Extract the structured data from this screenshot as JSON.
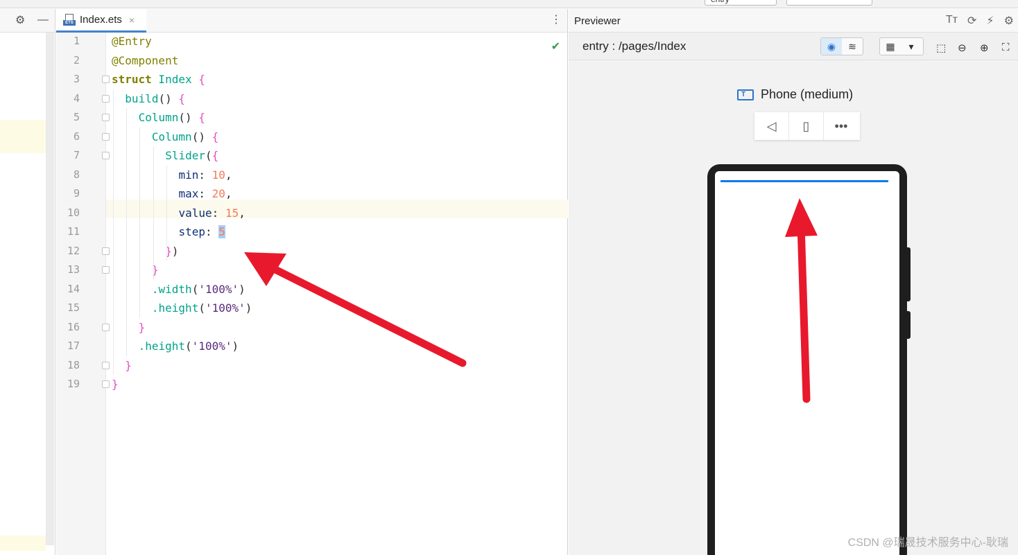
{
  "editor": {
    "tab_name": "Index.ets",
    "tab_close": "×",
    "lines": [
      {
        "n": "1",
        "indent": 0,
        "tokens": [
          {
            "t": "@Entry",
            "c": "ann"
          }
        ]
      },
      {
        "n": "2",
        "indent": 0,
        "tokens": [
          {
            "t": "@Component",
            "c": "ann"
          }
        ]
      },
      {
        "n": "3",
        "indent": 0,
        "tokens": [
          {
            "t": "struct",
            "c": "kw2b"
          },
          {
            "t": " Index ",
            "c": "fn"
          },
          {
            "t": "{",
            "c": "brace"
          }
        ]
      },
      {
        "n": "4",
        "indent": 2,
        "tokens": [
          {
            "t": "build",
            "c": "fn"
          },
          {
            "t": "() ",
            "c": "plain"
          },
          {
            "t": "{",
            "c": "brace"
          }
        ]
      },
      {
        "n": "5",
        "indent": 4,
        "tokens": [
          {
            "t": "Column",
            "c": "fn"
          },
          {
            "t": "() ",
            "c": "plain"
          },
          {
            "t": "{",
            "c": "brace"
          }
        ]
      },
      {
        "n": "6",
        "indent": 6,
        "tokens": [
          {
            "t": "Column",
            "c": "fn"
          },
          {
            "t": "() ",
            "c": "plain"
          },
          {
            "t": "{",
            "c": "brace"
          }
        ]
      },
      {
        "n": "7",
        "indent": 8,
        "tokens": [
          {
            "t": "Slider",
            "c": "fn"
          },
          {
            "t": "(",
            "c": "plain"
          },
          {
            "t": "{",
            "c": "brace"
          }
        ]
      },
      {
        "n": "8",
        "indent": 10,
        "tokens": [
          {
            "t": "min",
            "c": "prop"
          },
          {
            "t": ": ",
            "c": "plain"
          },
          {
            "t": "10",
            "c": "num"
          },
          {
            "t": ",",
            "c": "plain"
          }
        ]
      },
      {
        "n": "9",
        "indent": 10,
        "tokens": [
          {
            "t": "max",
            "c": "prop"
          },
          {
            "t": ": ",
            "c": "plain"
          },
          {
            "t": "20",
            "c": "num"
          },
          {
            "t": ",",
            "c": "plain"
          }
        ]
      },
      {
        "n": "10",
        "indent": 10,
        "tokens": [
          {
            "t": "value",
            "c": "prop"
          },
          {
            "t": ": ",
            "c": "plain"
          },
          {
            "t": "15",
            "c": "num"
          },
          {
            "t": ",",
            "c": "plain"
          }
        ]
      },
      {
        "n": "11",
        "indent": 10,
        "tokens": [
          {
            "t": "step",
            "c": "prop"
          },
          {
            "t": ": ",
            "c": "plain"
          },
          {
            "t": "5",
            "c": "num sel"
          }
        ]
      },
      {
        "n": "12",
        "indent": 8,
        "tokens": [
          {
            "t": "}",
            "c": "brace"
          },
          {
            "t": ")",
            "c": "plain"
          }
        ]
      },
      {
        "n": "13",
        "indent": 6,
        "tokens": [
          {
            "t": "}",
            "c": "brace"
          }
        ]
      },
      {
        "n": "14",
        "indent": 6,
        "tokens": [
          {
            "t": ".width",
            "c": "fn"
          },
          {
            "t": "(",
            "c": "plain"
          },
          {
            "t": "'100%'",
            "c": "str"
          },
          {
            "t": ")",
            "c": "plain"
          }
        ]
      },
      {
        "n": "15",
        "indent": 6,
        "tokens": [
          {
            "t": ".height",
            "c": "fn"
          },
          {
            "t": "(",
            "c": "plain"
          },
          {
            "t": "'100%'",
            "c": "str"
          },
          {
            "t": ")",
            "c": "plain"
          }
        ]
      },
      {
        "n": "16",
        "indent": 4,
        "tokens": [
          {
            "t": "}",
            "c": "brace"
          }
        ]
      },
      {
        "n": "17",
        "indent": 4,
        "tokens": [
          {
            "t": ".height",
            "c": "fn"
          },
          {
            "t": "(",
            "c": "plain"
          },
          {
            "t": "'100%'",
            "c": "str"
          },
          {
            "t": ")",
            "c": "plain"
          }
        ]
      },
      {
        "n": "18",
        "indent": 2,
        "tokens": [
          {
            "t": "}",
            "c": "brace"
          }
        ]
      },
      {
        "n": "19",
        "indent": 0,
        "tokens": [
          {
            "t": "}",
            "c": "brace"
          }
        ]
      }
    ],
    "current_line": "11"
  },
  "previewer": {
    "title": "Previewer",
    "path": "entry : /pages/Index",
    "device_label": "Phone (medium)",
    "slider_fill_fraction": 1.0,
    "slider_color": "#0a7af0"
  },
  "topbar": {
    "run_target": "entry"
  },
  "watermark": "CSDN @瑞晟技术服务中心-耿瑞",
  "colors": {
    "annotation_arrow": "#e8192c",
    "accent": "#2b73cc"
  }
}
